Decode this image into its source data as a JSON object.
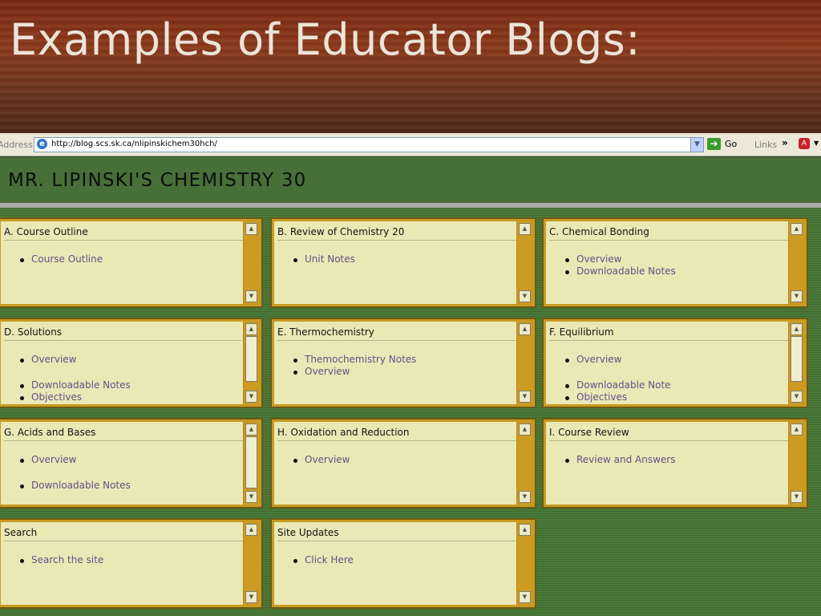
{
  "slide": {
    "title": "Examples of Educator Blogs:"
  },
  "browser": {
    "address_label": "Address",
    "url": "http://blog.scs.sk.ca/nlipinskichem30hch/",
    "go_label": "Go",
    "links_label": "Links",
    "chevron": "»"
  },
  "blog": {
    "title": "MR. LIPINSKI'S CHEMISTRY 30"
  },
  "panels": [
    {
      "title": "A. Course Outline",
      "links": [
        "Course Outline"
      ]
    },
    {
      "title": "B. Review of Chemistry 20",
      "links": [
        "Unit Notes"
      ]
    },
    {
      "title": "C. Chemical Bonding",
      "links": [
        "Overview",
        "Downloadable Notes"
      ]
    },
    {
      "title": "D. Solutions",
      "links": [
        "Overview",
        "Downloadable Notes",
        "Objectives"
      ]
    },
    {
      "title": "E. Thermochemistry",
      "links": [
        "Themochemistry Notes",
        "Overview"
      ]
    },
    {
      "title": "F. Equilibrium",
      "links": [
        "Overview",
        "Downloadable Note",
        "Objectives"
      ]
    },
    {
      "title": "G. Acids and Bases",
      "links": [
        "Overview",
        "Downloadable Notes"
      ]
    },
    {
      "title": "H. Oxidation and Reduction",
      "links": [
        "Overview"
      ]
    },
    {
      "title": "I. Course Review",
      "links": [
        "Review and Answers"
      ]
    },
    {
      "title": "Search",
      "links": [
        "Search the site"
      ]
    },
    {
      "title": "Site Updates",
      "links": [
        "Click Here"
      ]
    }
  ]
}
